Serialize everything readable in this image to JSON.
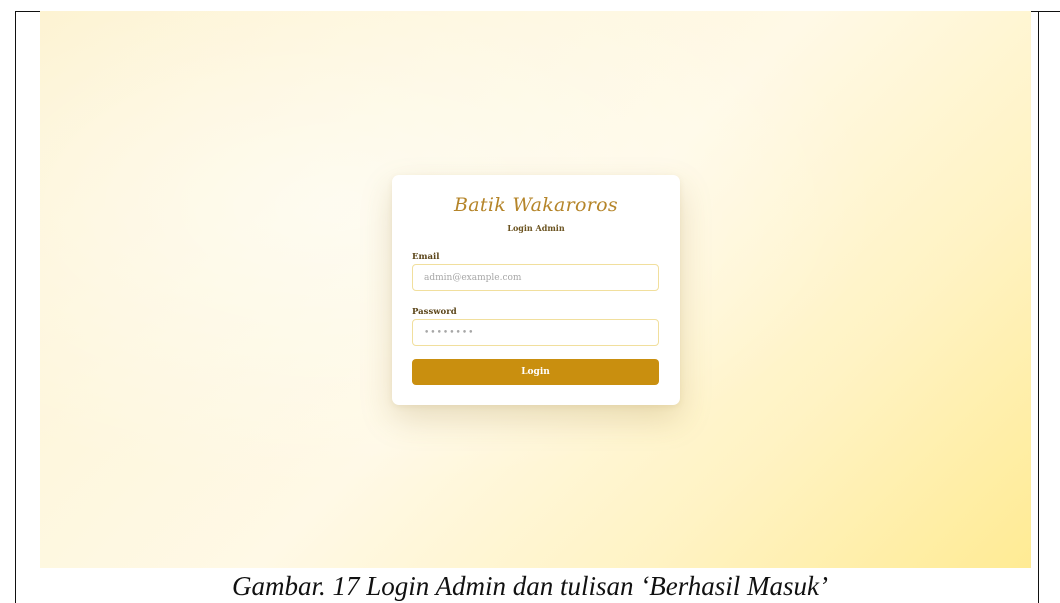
{
  "login_card": {
    "brand_title": "Batik Wakaroros",
    "subtitle": "Login Admin",
    "email_label": "Email",
    "email_placeholder": "admin@example.com",
    "email_value": "",
    "password_label": "Password",
    "password_placeholder": "••••••••",
    "password_value": "",
    "login_button_label": "Login"
  },
  "caption": {
    "text": "Gambar. 17 Login Admin dan tulisan ‘Berhasil Masuk’"
  },
  "colors": {
    "accent": "#c98f0f",
    "brand_text": "#b5852a",
    "input_border": "#f1df9d",
    "background_light": "#fff9e6",
    "background_warm": "#ffeb94"
  }
}
